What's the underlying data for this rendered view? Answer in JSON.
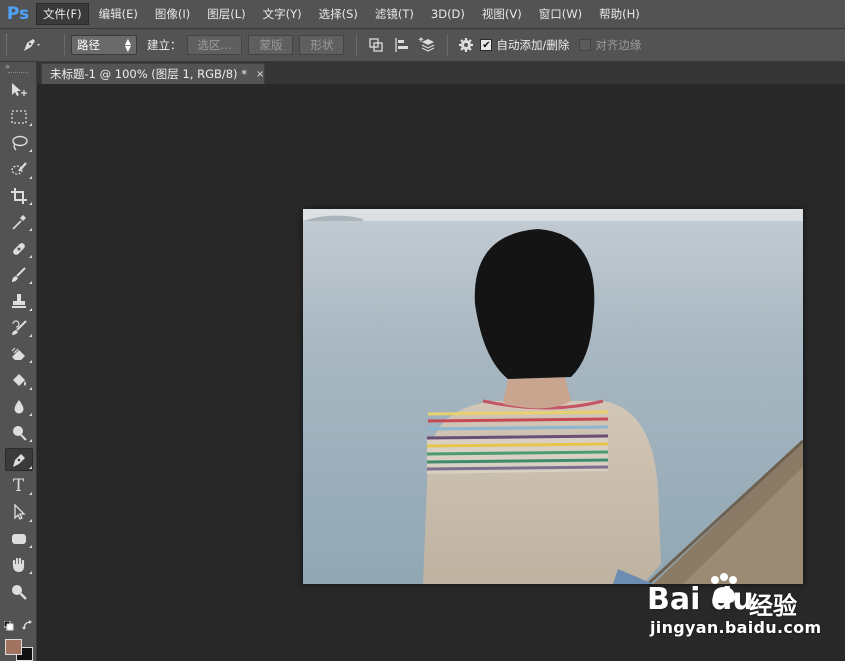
{
  "app": {
    "logo": "Ps"
  },
  "menu": [
    {
      "label": "文件(F)",
      "active": true
    },
    {
      "label": "编辑(E)"
    },
    {
      "label": "图像(I)"
    },
    {
      "label": "图层(L)"
    },
    {
      "label": "文字(Y)"
    },
    {
      "label": "选择(S)"
    },
    {
      "label": "滤镜(T)"
    },
    {
      "label": "3D(D)"
    },
    {
      "label": "视图(V)"
    },
    {
      "label": "窗口(W)"
    },
    {
      "label": "帮助(H)"
    }
  ],
  "options": {
    "tool_preset_icon": "pen-icon",
    "mode_select": "路径",
    "make_label": "建立：",
    "selection_button": "选区...",
    "mask_button": "蒙版",
    "shape_button": "形状",
    "path_ops_icon": "path-operations-icon",
    "path_align_icon": "path-alignment-icon",
    "path_arrange_icon": "path-arrangement-icon",
    "settings_icon": "gear-icon",
    "auto_add_delete": {
      "label": "自动添加/删除",
      "checked": true
    },
    "align_edges": {
      "label": "对齐边缘",
      "checked": false
    }
  },
  "document": {
    "tab_title": "未标题-1 @ 100% (图层 1, RGB/8) *",
    "close_symbol": "×"
  },
  "tools": [
    {
      "name": "move-tool",
      "icon": "move-icon"
    },
    {
      "name": "marquee-tool",
      "icon": "rect-marquee-icon"
    },
    {
      "name": "lasso-tool",
      "icon": "lasso-icon"
    },
    {
      "name": "quick-select-tool",
      "icon": "quick-select-icon"
    },
    {
      "name": "crop-tool",
      "icon": "crop-icon"
    },
    {
      "name": "eyedropper-tool",
      "icon": "eyedropper-icon"
    },
    {
      "name": "healing-tool",
      "icon": "bandage-icon"
    },
    {
      "name": "brush-tool",
      "icon": "brush-icon"
    },
    {
      "name": "stamp-tool",
      "icon": "stamp-icon"
    },
    {
      "name": "history-brush-tool",
      "icon": "history-brush-icon"
    },
    {
      "name": "eraser-tool",
      "icon": "eraser-icon"
    },
    {
      "name": "paint-bucket-tool",
      "icon": "paint-bucket-icon"
    },
    {
      "name": "blur-tool",
      "icon": "blur-drop-icon"
    },
    {
      "name": "dodge-tool",
      "icon": "dodge-icon"
    },
    {
      "name": "pen-tool",
      "icon": "pen-icon",
      "selected": true
    },
    {
      "name": "type-tool",
      "icon": "type-icon",
      "glyph": "T"
    },
    {
      "name": "path-select-tool",
      "icon": "path-select-arrow-icon"
    },
    {
      "name": "shape-tool",
      "icon": "rounded-rect-icon"
    },
    {
      "name": "hand-tool",
      "icon": "hand-icon"
    },
    {
      "name": "zoom-tool",
      "icon": "zoom-icon"
    }
  ],
  "colors": {
    "foreground": "#a07460",
    "background": "#111111",
    "ui_panel": "#535353",
    "canvas_bg": "#282828",
    "ps_blue": "#4fa3ff"
  },
  "watermark": {
    "logo": "Bai du",
    "brand": "经验",
    "url": "jingyan.baidu.com"
  }
}
